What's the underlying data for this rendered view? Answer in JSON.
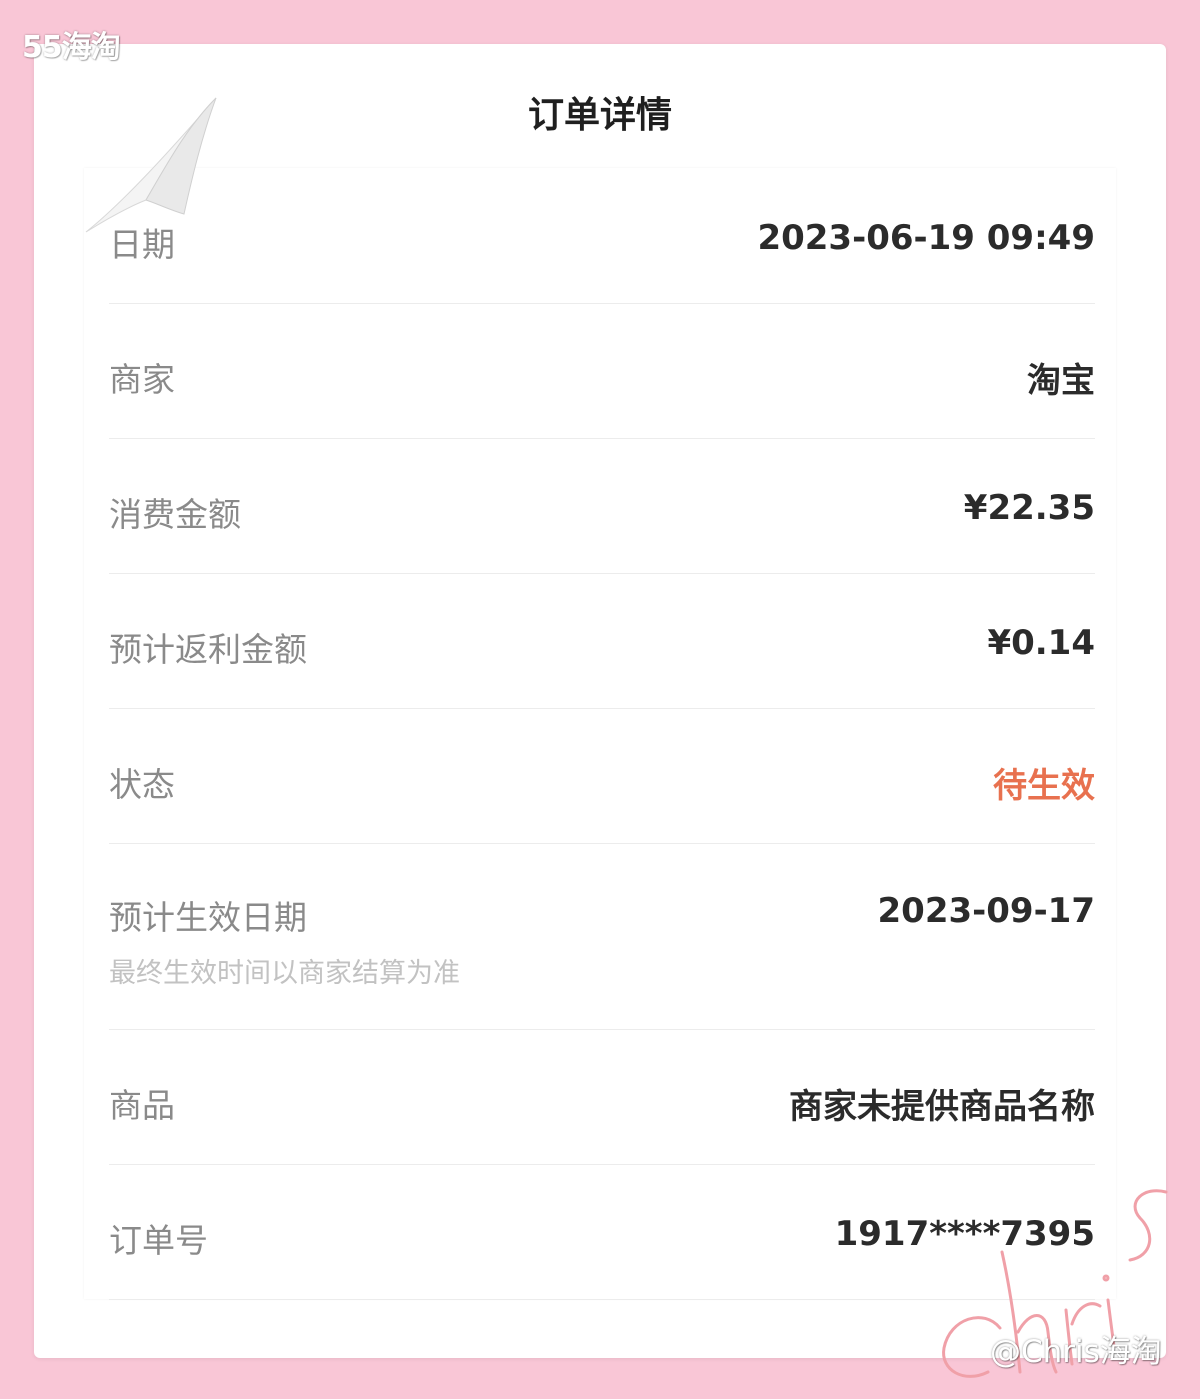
{
  "site_logo": "55海淘",
  "header": {
    "title": "订单详情"
  },
  "rows": [
    {
      "label": "日期",
      "value": "2023-06-19 09:49"
    },
    {
      "label": "商家",
      "value": "淘宝"
    },
    {
      "label": "消费金额",
      "value": "¥22.35"
    },
    {
      "label": "预计返利金额",
      "value": "¥0.14"
    },
    {
      "label": "状态",
      "value": "待生效"
    },
    {
      "label": "预计生效日期",
      "sublabel": "最终生效时间以商家结算为准",
      "value": "2023-09-17"
    },
    {
      "label": "商品",
      "value": "商家未提供商品名称"
    },
    {
      "label": "订单号",
      "value": "1917****7395"
    }
  ],
  "colors": {
    "background": "#f9c6d6",
    "status": "#e8714f",
    "signature": "#f0a0a8"
  },
  "signature_text": "Chris",
  "watermark": "@Chris海淘"
}
